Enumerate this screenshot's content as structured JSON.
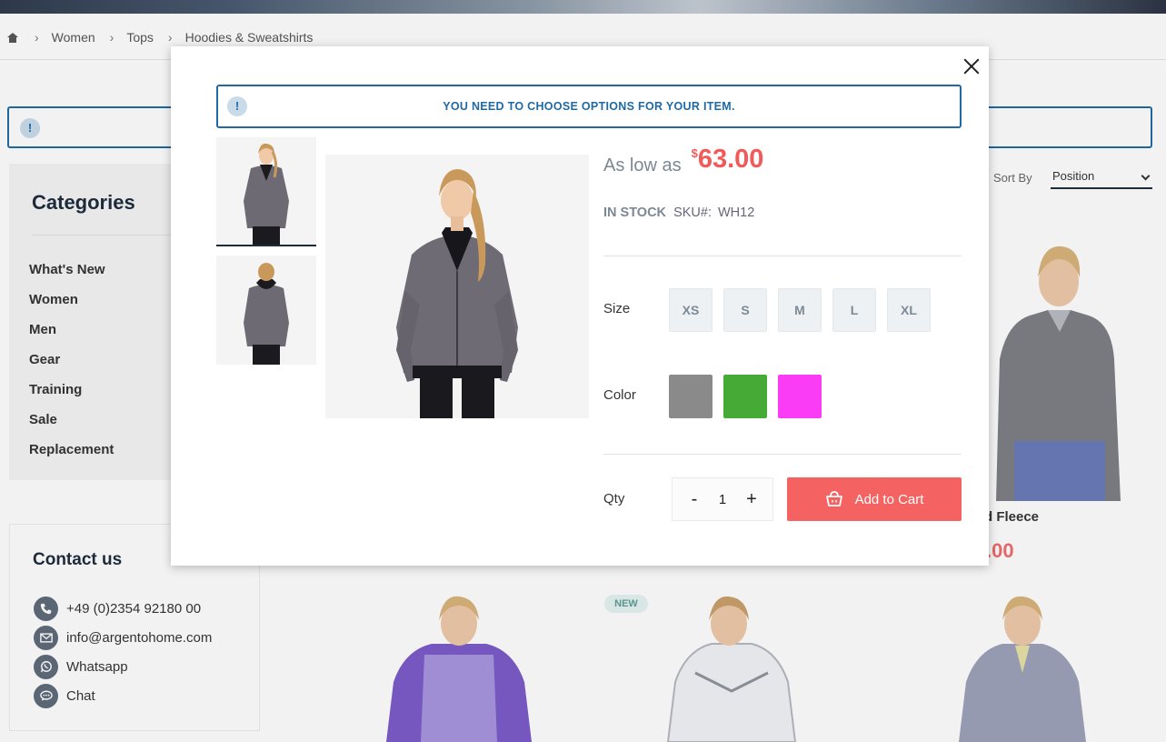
{
  "breadcrumb": {
    "items": [
      "Women",
      "Tops",
      "Hoodies & Sweatshirts"
    ]
  },
  "background_alert": {
    "icon": "!"
  },
  "categories": {
    "title": "Categories",
    "items": [
      "What's New",
      "Women",
      "Men",
      "Gear",
      "Training",
      "Sale",
      "Replacement"
    ]
  },
  "contact": {
    "title": "Contact us",
    "items": [
      {
        "icon": "phone-icon",
        "label": "+49 (0)2354 92180 00"
      },
      {
        "icon": "mail-icon",
        "label": "info@argentohome.com"
      },
      {
        "icon": "whatsapp-icon",
        "label": "Whatsapp"
      },
      {
        "icon": "chat-icon",
        "label": "Chat"
      }
    ]
  },
  "toolbar": {
    "sort_label": "Sort By",
    "sort_value": "Position"
  },
  "product_grid": {
    "partial_name": "d Fleece",
    "partial_price": ".00",
    "new_badge": "NEW"
  },
  "modal": {
    "alert_icon": "!",
    "alert_text": "YOU NEED TO CHOOSE OPTIONS FOR YOUR ITEM.",
    "price_label": "As low as",
    "currency": "$",
    "price": "63.00",
    "stock": "IN STOCK",
    "sku_label": "SKU#:",
    "sku_value": "WH12",
    "size_label": "Size",
    "sizes": [
      "XS",
      "S",
      "M",
      "L",
      "XL"
    ],
    "color_label": "Color",
    "colors": [
      "#8a8a8a",
      "#45ab36",
      "#fb3cf7"
    ],
    "qty_label": "Qty",
    "qty_minus": "-",
    "qty_value": "1",
    "qty_plus": "+",
    "add_to_cart": "Add to Cart"
  },
  "colors": {
    "accent_blue": "#1f6aa5",
    "price_red": "#f25a5a",
    "cart_button": "#f56262",
    "heading": "#1d2b3a"
  }
}
